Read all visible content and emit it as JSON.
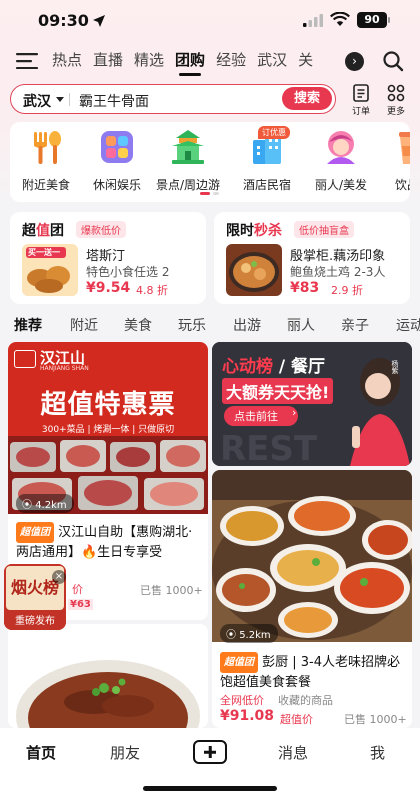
{
  "status": {
    "time": "09:30",
    "battery": "90"
  },
  "nav": {
    "tabs": [
      {
        "label": "热点",
        "active": false
      },
      {
        "label": "直播",
        "active": false
      },
      {
        "label": "精选",
        "active": false
      },
      {
        "label": "团购",
        "active": true
      },
      {
        "label": "经验",
        "active": false
      },
      {
        "label": "武汉",
        "active": false
      },
      {
        "label": "关",
        "active": false
      }
    ],
    "more_icon": "chevron-right-icon"
  },
  "search": {
    "city": "武汉",
    "query": "霸王牛骨面",
    "button": "搜索"
  },
  "tools": [
    {
      "label": "订单",
      "icon": "order-icon"
    },
    {
      "label": "更多",
      "icon": "grid-icon"
    }
  ],
  "categories": [
    {
      "label": "附近美食",
      "icon": "fork-spoon-icon"
    },
    {
      "label": "休闲娱乐",
      "icon": "apps-icon"
    },
    {
      "label": "景点/周边游",
      "icon": "pavilion-icon"
    },
    {
      "label": "酒店民宿",
      "icon": "buildings-icon",
      "badge": "订优惠"
    },
    {
      "label": "丽人/美发",
      "icon": "beauty-icon"
    },
    {
      "label": "饮品",
      "icon": "drink-icon"
    }
  ],
  "deals": [
    {
      "title_a": "超",
      "title_hl": "值",
      "title_b": "团",
      "tag": "爆款低价",
      "name": "塔斯汀",
      "sub": "特色小食任选 2",
      "price": "¥9.54",
      "discount": "4.8 折",
      "img_text": "买一送一"
    },
    {
      "title_a": "限时",
      "title_hl": "秒杀",
      "title_b": "",
      "tag": "低价抽盲盒",
      "name": "殷掌柜.藕汤印象",
      "sub": "鲍鱼烧土鸡 2-3人",
      "price": "¥83",
      "discount": "2.9 折"
    }
  ],
  "feed_tabs": [
    {
      "label": "推荐",
      "active": true
    },
    {
      "label": "附近",
      "active": false
    },
    {
      "label": "美食",
      "active": false
    },
    {
      "label": "玩乐",
      "active": false
    },
    {
      "label": "出游",
      "active": false
    },
    {
      "label": "丽人",
      "active": false
    },
    {
      "label": "亲子",
      "active": false
    },
    {
      "label": "运动",
      "active": false
    }
  ],
  "feed": {
    "card1": {
      "brand": "汉江山",
      "brand_en": "HANJIANG SHAN",
      "banner_title": "超值特惠票",
      "banner_sub": "300+菜品 | 烤涮一体 | 只做原切",
      "distance": "4.2km",
      "badge": "超值团",
      "title": "汉江山自助【惠购湖北·两店通用】🔥生日专享受",
      "meta_tag": "价",
      "price_tag": "¥63",
      "sold": "已售 1000+"
    },
    "banner2": {
      "title_a": "心动榜",
      "title_b": "餐厅",
      "headline": "大额券天天抢!",
      "button": "点击前往",
      "person": "杨紫"
    },
    "card2": {
      "distance": "5.2km",
      "badge": "超值团",
      "title": "彭厨 | 3-4人老味招牌必饱超值美食套餐",
      "tag1": "全网低价",
      "tag2": "收藏的商品",
      "price": "¥91.08",
      "price_label": "超值价",
      "sold": "已售 1000+"
    }
  },
  "float_badge": {
    "line1": "烟火榜",
    "line2": "重磅发布"
  },
  "bottom_nav": [
    {
      "label": "首页",
      "active": true
    },
    {
      "label": "朋友",
      "active": false
    },
    {
      "label": "消息",
      "active": false
    },
    {
      "label": "我",
      "active": false
    }
  ],
  "colors": {
    "brand_red": "#e8384f",
    "orange": "#ff7a1a"
  }
}
